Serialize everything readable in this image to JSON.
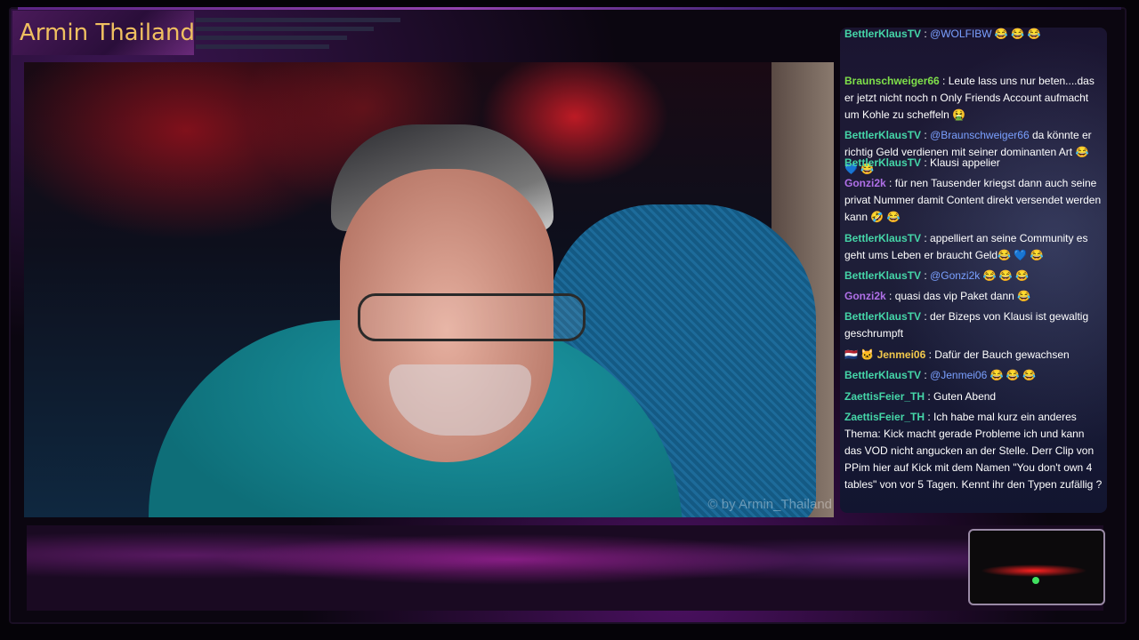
{
  "overlay": {
    "title": "Armin Thailand",
    "watermark": "© by Armin_Thailand"
  },
  "chat": {
    "messages": [
      {
        "user": "BettlerKlausTV",
        "color": "#45d6a8",
        "parts": [
          {
            "type": "mention",
            "text": "@WOLFIBW"
          },
          {
            "type": "emote",
            "text": " 😂 😂 😂"
          }
        ]
      },
      {
        "user": "Braunschweiger66",
        "color": "#7fe04a",
        "parts": [
          {
            "type": "text",
            "text": "Leute lass uns nur beten....das er jetzt nicht noch n Only Friends Account aufmacht um Kohle zu scheffeln 🤮"
          }
        ]
      },
      {
        "user": "BettlerKlausTV",
        "color": "#45d6a8",
        "parts": [
          {
            "type": "mention",
            "text": "@Braunschweiger66"
          },
          {
            "type": "text",
            "text": " da könnte er richtig Geld verdienen mit seiner dominanten Art "
          },
          {
            "type": "emote",
            "text": "😂 💙 😂"
          }
        ]
      },
      {
        "user": "BettlerKlausTV",
        "color": "#45d6a8",
        "parts": [
          {
            "type": "text",
            "text": "Klausi appelier"
          }
        ]
      },
      {
        "user": "Gonzi2k",
        "color": "#b070e8",
        "parts": [
          {
            "type": "text",
            "text": "für nen Tausender kriegst dann auch seine privat Nummer damit Content direkt versendet werden kann "
          },
          {
            "type": "emote",
            "text": "🤣 😂"
          }
        ]
      },
      {
        "user": "BettlerKlausTV",
        "color": "#45d6a8",
        "parts": [
          {
            "type": "text",
            "text": "appelliert an seine Community es geht ums Leben er braucht Geld"
          },
          {
            "type": "emote",
            "text": "😂 💙 😂"
          }
        ]
      },
      {
        "user": "BettlerKlausTV",
        "color": "#45d6a8",
        "parts": [
          {
            "type": "mention",
            "text": "@Gonzi2k"
          },
          {
            "type": "emote",
            "text": " 😂 😂 😂"
          }
        ]
      },
      {
        "user": "Gonzi2k",
        "color": "#b070e8",
        "parts": [
          {
            "type": "text",
            "text": "quasi das vip Paket dann "
          },
          {
            "type": "emote",
            "text": "😂"
          }
        ]
      },
      {
        "user": "BettlerKlausTV",
        "color": "#45d6a8",
        "parts": [
          {
            "type": "text",
            "text": "der Bizeps von Klausi ist gewaltig geschrumpft"
          }
        ]
      },
      {
        "user": "Jenmei06",
        "color": "#f2c94c",
        "badge": "🇳🇱 🐱",
        "parts": [
          {
            "type": "text",
            "text": "Dafür der Bauch gewachsen"
          }
        ]
      },
      {
        "user": "BettlerKlausTV",
        "color": "#45d6a8",
        "parts": [
          {
            "type": "mention",
            "text": "@Jenmei06"
          },
          {
            "type": "emote",
            "text": " 😂 😂 😂"
          }
        ]
      },
      {
        "user": "ZaettisFeier_TH",
        "color": "#45d6a8",
        "parts": [
          {
            "type": "text",
            "text": "Guten Abend"
          }
        ]
      },
      {
        "user": "ZaettisFeier_TH",
        "color": "#45d6a8",
        "parts": [
          {
            "type": "text",
            "text": "Ich habe mal kurz ein anderes Thema: Kick macht gerade Probleme ich und kann das VOD nicht angucken an der Stelle. Derr Clip von PPim hier auf Kick mit dem Namen \"You don't own 4 tables\" von vor 5 Tagen. Kennt ihr den Typen zufällig ?"
          }
        ]
      }
    ]
  }
}
